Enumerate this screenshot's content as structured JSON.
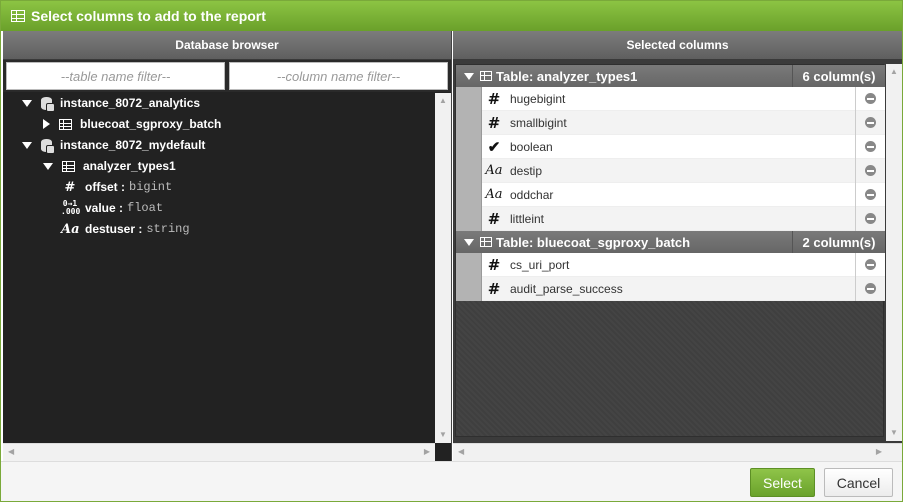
{
  "dialog": {
    "title": "Select columns to add to the report"
  },
  "left_panel": {
    "header": "Database browser",
    "table_filter_placeholder": "--table name filter--",
    "column_filter_placeholder": "--column name filter--",
    "tree": [
      {
        "label": "instance_8072_analytics",
        "kind": "database",
        "expanded": true
      },
      {
        "label": "bluecoat_sgproxy_batch",
        "kind": "table",
        "expanded": false
      },
      {
        "label": "instance_8072_mydefault",
        "kind": "database",
        "expanded": true
      },
      {
        "label": "analyzer_types1",
        "kind": "table",
        "expanded": true
      },
      {
        "label": "offset :",
        "type": "bigint",
        "icon": "hash-icon"
      },
      {
        "label": "value :",
        "type": "float",
        "icon": "float-icon"
      },
      {
        "label": "destuser :",
        "type": "string",
        "icon": "string-icon"
      }
    ]
  },
  "right_panel": {
    "header": "Selected columns",
    "groups": [
      {
        "title": "Table: analyzer_types1",
        "count": "6 column(s)",
        "columns": [
          {
            "name": "hugebigint",
            "icon_char": "#"
          },
          {
            "name": "smallbigint",
            "icon_char": "#"
          },
          {
            "name": "boolean",
            "icon_char": "✔"
          },
          {
            "name": "destip",
            "icon_char": "Aa"
          },
          {
            "name": "oddchar",
            "icon_char": "Aa"
          },
          {
            "name": "littleint",
            "icon_char": "#"
          }
        ]
      },
      {
        "title": "Table: bluecoat_sgproxy_batch",
        "count": "2 column(s)",
        "columns": [
          {
            "name": "cs_uri_port",
            "icon_char": "#"
          },
          {
            "name": "audit_parse_success",
            "icon_char": "#"
          }
        ]
      }
    ]
  },
  "footer": {
    "select_label": "Select",
    "cancel_label": "Cancel"
  },
  "colors": {
    "accent": "#78b236",
    "panel_dark": "#222222"
  }
}
